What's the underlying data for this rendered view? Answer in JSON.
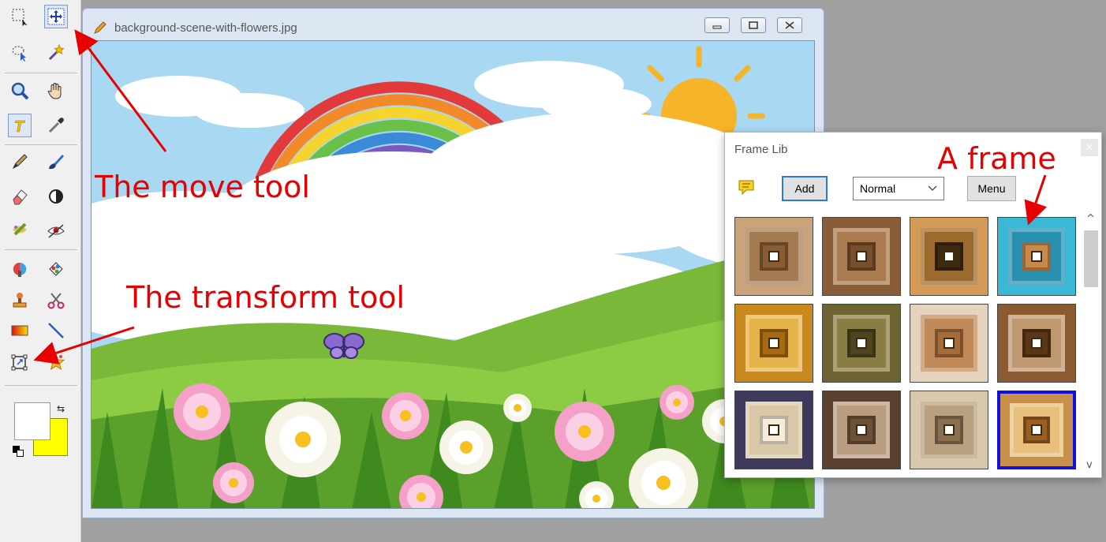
{
  "document": {
    "title": "background-scene-with-flowers.jpg",
    "window_buttons": [
      "minimize",
      "restore",
      "close"
    ]
  },
  "toolbar": {
    "tools": [
      "rect-select",
      "move",
      "lasso-select",
      "magic-wand",
      "zoom",
      "hand",
      "text",
      "eyedropper",
      "pencil",
      "brush",
      "eraser",
      "contrast",
      "smudge",
      "red-eye",
      "clone",
      "color-replace",
      "stamp",
      "scissors",
      "gradient",
      "line",
      "transform",
      "star-shape"
    ],
    "colors": {
      "foreground": "#ffffff",
      "background": "#ffff00"
    }
  },
  "frame_lib": {
    "title": "Frame Lib",
    "add_label": "Add",
    "mode_value": "Normal",
    "menu_label": "Menu",
    "close_glyph": "×",
    "scroll_up": "^",
    "scroll_down": "v",
    "frames": [
      {
        "outer": "#c9a37a",
        "mid": "#a47a52",
        "inner": "#8a5c34"
      },
      {
        "outer": "#8a5c38",
        "mid": "#a97b4e",
        "inner": "#7a4e2c"
      },
      {
        "outer": "#d39a58",
        "mid": "#9c6a2c",
        "inner": "#3e2a10"
      },
      {
        "outer": "#3ab8d6",
        "mid": "#2a90b0",
        "inner": "#c88a4a"
      },
      {
        "outer": "#c8891e",
        "mid": "#e6b24a",
        "inner": "#a86a10"
      },
      {
        "outer": "#6d6432",
        "mid": "#8a7d44",
        "inner": "#4e4520"
      },
      {
        "outer": "#e6d3bd",
        "mid": "#c08a58",
        "inner": "#a56b38"
      },
      {
        "outer": "#8a5a30",
        "mid": "#c09870",
        "inner": "#5a3616"
      },
      {
        "outer": "#3e3a5c",
        "mid": "#d8c8a8",
        "inner": "#f6ecd8"
      },
      {
        "outer": "#5a4030",
        "mid": "#b89c80",
        "inner": "#6e5038"
      },
      {
        "outer": "#d8c8ac",
        "mid": "#b8a080",
        "inner": "#8a7050"
      },
      {
        "outer": "#c8904a",
        "mid": "#e8c07c",
        "inner": "#9a5e20"
      }
    ]
  },
  "annotations": {
    "move_tool": "The move tool",
    "transform_tool": "The transform tool",
    "a_frame": "A frame"
  }
}
